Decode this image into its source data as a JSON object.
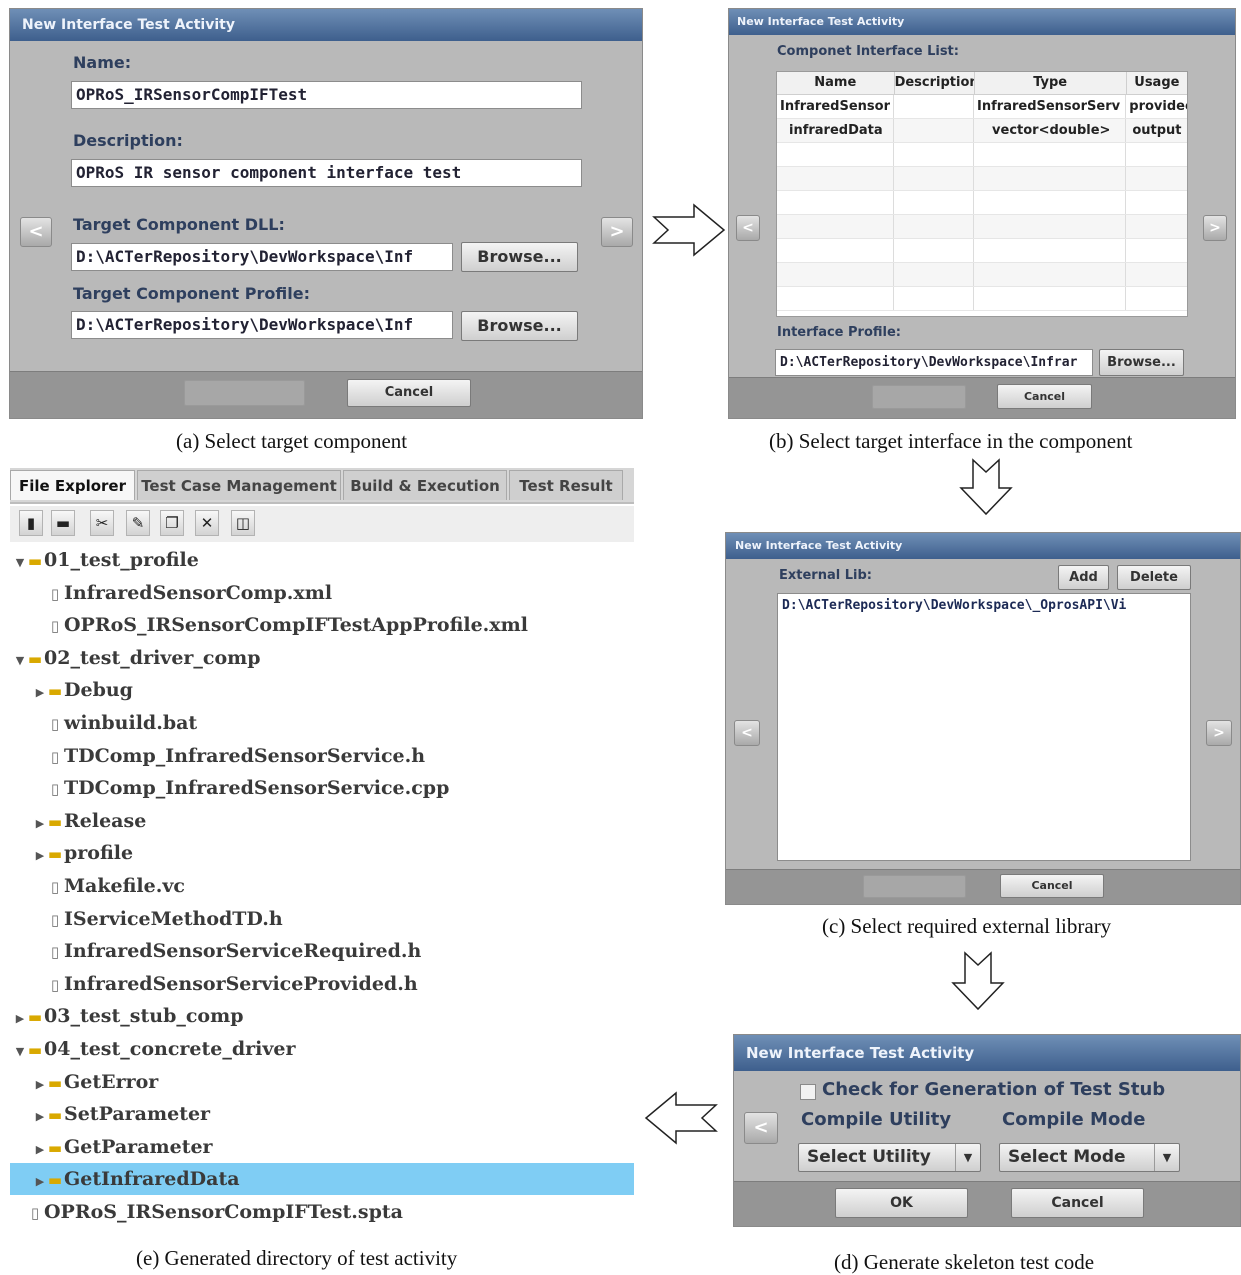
{
  "panel_a": {
    "title": "New Interface Test Activity",
    "name_label": "Name:",
    "name_value": "OPRoS_IRSensorCompIFTest",
    "description_label": "Description:",
    "description_value": "OPRoS IR sensor component interface test",
    "dll_label": "Target Component DLL:",
    "dll_value": "D:\\ACTerRepository\\DevWorkspace\\Inf",
    "profile_label": "Target Component Profile:",
    "profile_value": "D:\\ACTerRepository\\DevWorkspace\\Inf",
    "browse_label": "Browse...",
    "cancel_label": "Cancel",
    "caption": "(a) Select target component"
  },
  "panel_b": {
    "title": "New Interface Test Activity",
    "list_label": "Componet Interface List:",
    "columns": [
      "Name",
      "Description",
      "Type",
      "Usage"
    ],
    "rows": [
      [
        "InfraredSensor",
        "",
        "InfraredSensorServ",
        "providec"
      ],
      [
        "infraredData",
        "",
        "vector<double>",
        "output"
      ]
    ],
    "profile_label": "Interface Profile:",
    "profile_value": "D:\\ACTerRepository\\DevWorkspace\\Infrar",
    "browse_label": "Browse...",
    "cancel_label": "Cancel",
    "caption": "(b) Select target interface in the component"
  },
  "panel_c": {
    "title": "New Interface Test Activity",
    "ext_lib_label": "External Lib:",
    "add_label": "Add",
    "delete_label": "Delete",
    "lib_entry": "D:\\ACTerRepository\\DevWorkspace\\_OprosAPI\\Vi",
    "cancel_label": "Cancel",
    "caption": "(c) Select required external library"
  },
  "panel_d": {
    "title": "New Interface Test Activity",
    "checkbox_label": "Check for Generation of Test Stub",
    "compile_utility_label": "Compile Utility",
    "compile_mode_label": "Compile Mode",
    "utility_select": "Select Utility",
    "mode_select": "Select Mode",
    "ok_label": "OK",
    "cancel_label": "Cancel",
    "caption": "(d) Generate skeleton test code"
  },
  "panel_e": {
    "tabs": [
      "File Explorer",
      "Test Case Management",
      "Build & Execution",
      "Test Result"
    ],
    "active_tab": "File Explorer",
    "toolbar_icons": [
      "new-file-icon",
      "open-folder-icon",
      "cut-icon",
      "edit-icon",
      "copy-icon",
      "delete-icon",
      "split-icon"
    ],
    "tree": [
      {
        "label": "01_test_profile",
        "type": "folder",
        "depth": 0,
        "expanded": true
      },
      {
        "label": "InfraredSensorComp.xml",
        "type": "file",
        "depth": 1
      },
      {
        "label": "OPRoS_IRSensorCompIFTestAppProfile.xml",
        "type": "file",
        "depth": 1
      },
      {
        "label": "02_test_driver_comp",
        "type": "folder",
        "depth": 0,
        "expanded": true
      },
      {
        "label": "Debug",
        "type": "folder",
        "depth": 1,
        "expanded": false
      },
      {
        "label": "winbuild.bat",
        "type": "file",
        "depth": 1
      },
      {
        "label": "TDComp_InfraredSensorService.h",
        "type": "file",
        "depth": 1
      },
      {
        "label": "TDComp_InfraredSensorService.cpp",
        "type": "file",
        "depth": 1
      },
      {
        "label": "Release",
        "type": "folder",
        "depth": 1,
        "expanded": false
      },
      {
        "label": "profile",
        "type": "folder",
        "depth": 1,
        "expanded": false
      },
      {
        "label": "Makefile.vc",
        "type": "file",
        "depth": 1
      },
      {
        "label": "IServiceMethodTD.h",
        "type": "file",
        "depth": 1
      },
      {
        "label": "InfraredSensorServiceRequired.h",
        "type": "file",
        "depth": 1
      },
      {
        "label": "InfraredSensorServiceProvided.h",
        "type": "file",
        "depth": 1
      },
      {
        "label": "03_test_stub_comp",
        "type": "folder",
        "depth": 0,
        "expanded": false
      },
      {
        "label": "04_test_concrete_driver",
        "type": "folder",
        "depth": 0,
        "expanded": true
      },
      {
        "label": "GetError",
        "type": "folder",
        "depth": 1,
        "expanded": false
      },
      {
        "label": "SetParameter",
        "type": "folder",
        "depth": 1,
        "expanded": false
      },
      {
        "label": "GetParameter",
        "type": "folder",
        "depth": 1,
        "expanded": false
      },
      {
        "label": "GetInfraredData",
        "type": "folder",
        "depth": 1,
        "expanded": false,
        "selected": true
      },
      {
        "label": "OPRoS_IRSensorCompIFTest.spta",
        "type": "file",
        "depth": 0
      }
    ],
    "caption": "(e) Generated directory of test activity"
  },
  "colors": {
    "titlebar": "#4a6a96",
    "panel_bg": "#b9b9b9",
    "label_text": "#2e3f5e",
    "selection": "#7fcdf4",
    "folder": "#d9a900"
  }
}
